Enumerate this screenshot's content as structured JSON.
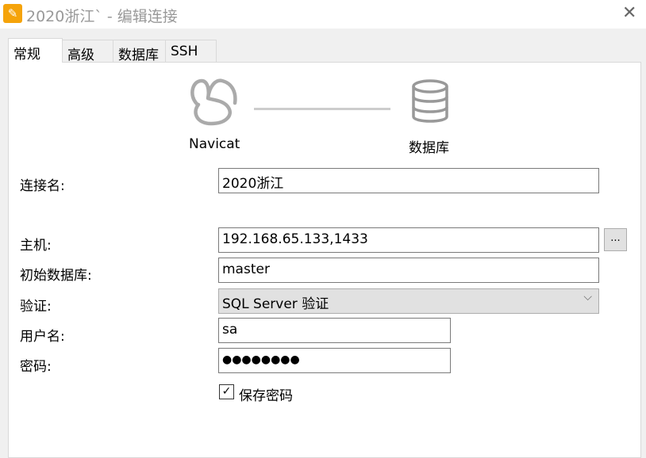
{
  "window": {
    "title": "2020浙江` - 编辑连接",
    "close_icon": "close-icon",
    "app_icon": "navicat-app-icon"
  },
  "tabs": [
    {
      "label": "常规",
      "active": true
    },
    {
      "label": "高级"
    },
    {
      "label": "数据库"
    },
    {
      "label": "SSH"
    }
  ],
  "diagram": {
    "left_label": "Navicat",
    "right_label": "数据库"
  },
  "form": {
    "connection_name": {
      "label": "连接名:",
      "value": "2020浙江"
    },
    "host": {
      "label": "主机:",
      "value": "192.168.65.133,1433",
      "browse": "..."
    },
    "initial_db": {
      "label": "初始数据库:",
      "value": "master"
    },
    "auth": {
      "label": "验证:",
      "value": "SQL Server 验证"
    },
    "username": {
      "label": "用户名:",
      "value": "sa"
    },
    "password": {
      "label": "密码:",
      "value": "●●●●●●●●"
    },
    "save_password": {
      "label": "保存密码",
      "checked": true
    }
  }
}
